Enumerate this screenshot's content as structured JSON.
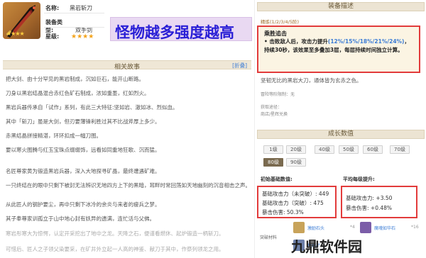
{
  "weapon": {
    "name_label": "名称:",
    "name_value": "黑岩斩刀",
    "type_label": "装备类型:",
    "type_value": "双手剑",
    "rarity_label": "星级:",
    "rarity_value": "★★★★",
    "thumb_stars": "★★★★"
  },
  "promo_text": "怪物越多强度越高",
  "story": {
    "header": "相关故事",
    "fold_label": "[折叠]",
    "lines": [
      "把大剑、由十分罕见的黑岩制成，沉如巨石，能开山断路。",
      "刀身以黑岩结晶混合赤红色矿石制成，浓如重墨，红如烈火。",
      "黑岩兵器传承自「试作」系列，有此三大特征:坚如岩、澈如冰、烈似血。",
      "其中「斩刀」虽是大剑，但刃要薄锋利胜过其不比战斧厚上多少。",
      "赤黑结晶拼接精湛，环环扣成一幅刀图。",
      "要以寒火图腾与红玉宝珠点缀缀饰，远看如同重地狂歌、沉而猛。",
      "名匠尊家黄为锻造黑岩兵器，深入大地探寻矿晶，最终遭遇矿难。",
      "一只终结在的眼中只剩下被封无法辨识无地四方上下的黑暗，耳畔时常回荡如天地幽刻的沉音相击之声。",
      "从此匠人的钢护要尘，再中只剩下冰冷的余炎与来者的瘦兵之梦。",
      "其子奉尊家训孤立于山中地心封有妖异的遗满，连忙活与父佛。",
      "寒岩彤寒大为惊愕，认定开采挖出了地中之龙。天降之石，便谨看燃休、起炉锻造一柄斩刀。",
      "可惜后、匠人之子领父染要采，在矿井外立起一人高的神鉴、献刀于其中，作祭列领龙之用。"
    ]
  },
  "equip": {
    "header": "装备描述",
    "refine_label": "精炼(1/2/3/4/5阶)",
    "effect_title": "乘胜追击",
    "effect_pre": "• 击败敌人后，攻击力提升",
    "effect_hl": "(12%/15%/18%/21%/24%)",
    "effect_post": "，持续30秒，该效果至多叠加3层，每层持续时间独立计算。",
    "effect_line3": "续30秒，该效果至多叠加3层，每层持续时间独（如）立。",
    "desc": "坚韧无比的黑岩大刀，通体皆为玄赤之色。",
    "small1": "冒险等阶限制：无",
    "small2": "获取途径：",
    "small3": "商店/星辉兑换"
  },
  "growth": {
    "header": "成长数值",
    "levels": [
      "1级",
      "20级",
      "40级",
      "50级",
      "60级",
      "70级",
      "80级",
      "90级"
    ],
    "active_level": "80级",
    "base_head": "初始基础数值:",
    "avg_head": "平均每级提升:",
    "base_lines": [
      "基础攻击力（未突破）: 449",
      "基础攻击力（突破）: 475",
      "暴击伤害: 50.3%"
    ],
    "avg_lines": [
      "基础攻击力: +3.50",
      "暴击伤害: +0.48%"
    ]
  },
  "sets": {
    "label": "突破材料",
    "items": [
      {
        "name": "激励石头",
        "num": "*4"
      },
      {
        "name": "魔魂如华石",
        "num": "*16"
      },
      {
        "name": "星烟矿",
        "num": ""
      }
    ]
  },
  "watermark": "九鼎软件园",
  "colors": {
    "promo_text": "#2a1fd6",
    "promo_bg": "#e9d9f2",
    "highlight_border": "#e23b3b",
    "link_blue": "#3a7bd5",
    "gold": "#f3a31b"
  }
}
